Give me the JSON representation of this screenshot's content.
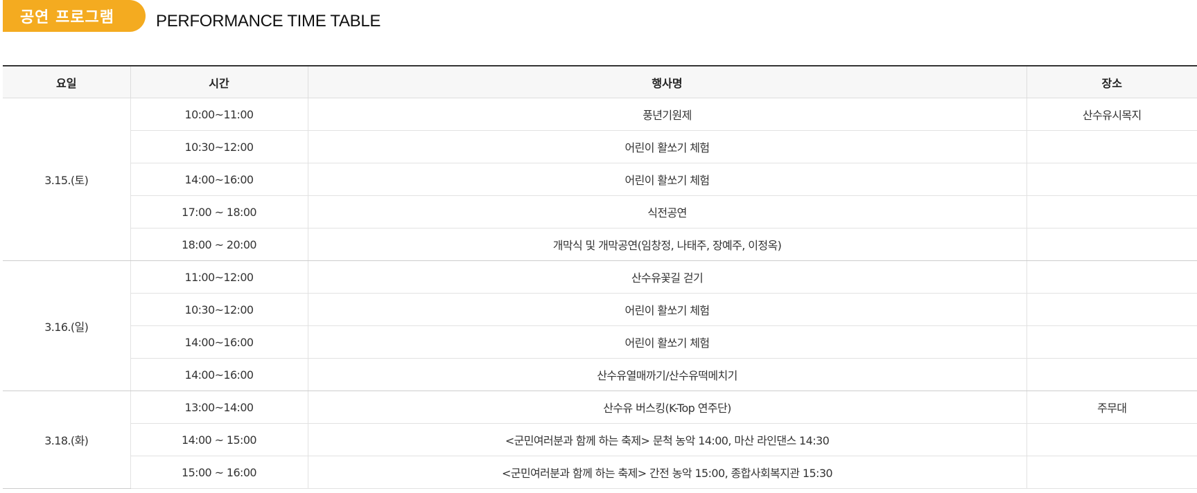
{
  "header": {
    "badge_label": "공연 프로그램",
    "title": "PERFORMANCE TIME TABLE"
  },
  "colors": {
    "accent": "#f4ab20",
    "header_bg": "#f7f7f7",
    "border": "#e2e2e2"
  },
  "table": {
    "columns": [
      "요일",
      "시간",
      "행사명",
      "장소"
    ],
    "groups": [
      {
        "day": "3.15.(토)",
        "rows": [
          {
            "time": "10:00~11:00",
            "event": "풍년기원제",
            "place": "산수유시목지"
          },
          {
            "time": "10:30~12:00",
            "event": "어린이 활쏘기 체험",
            "place": ""
          },
          {
            "time": "14:00~16:00",
            "event": "어린이 활쏘기 체험",
            "place": ""
          },
          {
            "time": "17:00 ~ 18:00",
            "event": "식전공연",
            "place": ""
          },
          {
            "time": "18:00 ~ 20:00",
            "event": "개막식 및 개막공연(임창정, 나태주, 장예주, 이정옥)",
            "place": ""
          }
        ]
      },
      {
        "day": "3.16.(일)",
        "rows": [
          {
            "time": "11:00~12:00",
            "event": "산수유꽃길 걷기",
            "place": ""
          },
          {
            "time": "10:30~12:00",
            "event": "어린이 활쏘기 체험",
            "place": ""
          },
          {
            "time": "14:00~16:00",
            "event": "어린이 활쏘기 체험",
            "place": ""
          },
          {
            "time": "14:00~16:00",
            "event": "산수유열매까기/산수유떡메치기",
            "place": ""
          }
        ]
      },
      {
        "day": "3.18.(화)",
        "rows": [
          {
            "time": "13:00~14:00",
            "event": "산수유 버스킹(K-Top 연주단)",
            "place": "주무대"
          },
          {
            "time": "14:00 ~ 15:00",
            "event": "<군민여러분과 함께 하는 축제> 문척 농악 14:00, 마산 라인댄스 14:30",
            "place": ""
          },
          {
            "time": "15:00 ~ 16:00",
            "event": "<군민여러분과 함께 하는 축제> 간전 농악 15:00, 종합사회복지관 15:30",
            "place": ""
          }
        ]
      }
    ]
  }
}
